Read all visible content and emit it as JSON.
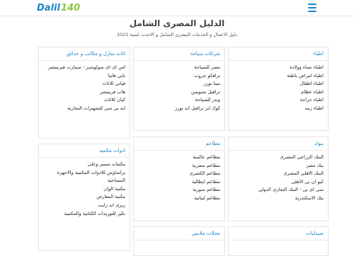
{
  "header": {
    "logo_part1": "Dalil",
    "logo_part2": "140",
    "menu_icon": "hamburger-menu-icon",
    "accent_color": "#1a84c7",
    "logo_green": "#8cc63f"
  },
  "page": {
    "title": "الدليل المصرى الشامل",
    "subtitle": "دليل الاعمال و الخدمات المصرى الشامل و الاحدث لسنة 2021"
  },
  "categories": [
    {
      "title": "اطباء",
      "items": [
        "اطباء نساء وولادة",
        "اطباء امراض باطنة",
        "اطباء اطفال",
        "اطباء عظام",
        "اطباء جراحة",
        "اطباء زمد"
      ]
    },
    {
      "title": "شركات سياحة",
      "items": [
        "مصر للسياحة",
        "ترافكو جروب",
        "مينا تورز",
        "ترافيل تشويس",
        "وندر للسياحة",
        "كوك ابر ترافيل اند تورز"
      ]
    },
    {
      "title": "اثاث منازل و مكاتب و حدائق",
      "items": [
        "اس اى اى سولوشنز - سمارت فيرنيتشر",
        "ناتى فاتيا",
        "فيانى للاثاث",
        "هاب فرنيتشر",
        "كيان للاثاث",
        "ايه بى سى للتجهيزات التجارية"
      ]
    },
    {
      "title": "بنوك",
      "items": [
        "البنك الزراعى المصرى",
        "بنك مصر",
        "البنك الاهلى المصرى",
        "كيو ان بى الاهلى",
        "سى اى بى - البنك التجارى الدولى",
        "بنك الاسكندرية"
      ]
    },
    {
      "title": "مطاعم",
      "items": [
        "مطاعم عالمية",
        "مطاعم مصرية",
        "مطاعم الكشرى",
        "مطاعم ايطالية",
        "مطاعم سورية",
        "مطاعم لبنانية"
      ]
    },
    {
      "title": "ادوات مكتبية",
      "items": [
        "مكتبات سمير وعلى",
        "براساوس للادوات المكتبية والاجهزة المساحية",
        "مكتبة الوان",
        "مكتبة المعارض",
        "زيزى اند زايب",
        "نكير للتوريدات الكتابية والمكتبية"
      ]
    },
    {
      "title": "صيدليات",
      "items": []
    },
    {
      "title": "محلات ملابس",
      "items": []
    }
  ]
}
